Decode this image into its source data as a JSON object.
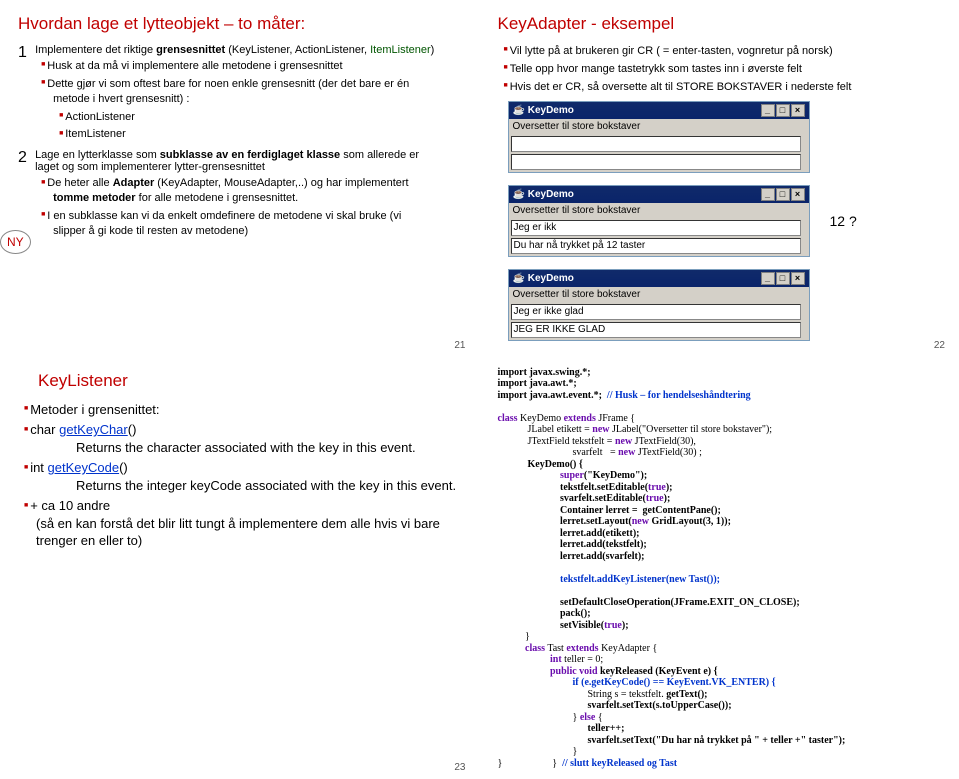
{
  "slide21": {
    "title": "Hvordan lage et lytteobjekt – to måter:",
    "num1": "1",
    "p1": "Implementere det riktige grensesnittet (KeyListener, ActionListener, ItemListener)",
    "b1": "Husk at da må vi implementere alle metodene i grensesnittet",
    "b2": "Dette gjør vi som oftest bare for noen enkle grensesnitt (der det bare er én metode i hvert grensesnitt) :",
    "b2a": "ActionListener",
    "b2b": "ItemListener",
    "num2": "2",
    "p2": "Lage en lytterklasse som subklasse av en ferdiglaget klasse som allerede er laget og som implementerer lytter-grensesnittet",
    "b3a": "De heter alle Adapter (KeyAdapter, MouseAdapter,..) og har implementert tomme metoder for alle metodene i grensesnittet.",
    "b3b": "I en subklasse kan vi da enkelt omdefinere de metodene vi skal bruke (vi slipper å gi kode til resten av metodene)",
    "ny": "NY",
    "pagenum": "21"
  },
  "slide22": {
    "title": "KeyAdapter - eksempel",
    "b1": "Vil lytte på at brukeren gir CR  ( = enter-tasten, vognretur på norsk)",
    "b2": "Telle opp hvor mange tastetrykk som tastes inn i øverste felt",
    "b3": "Hvis det er CR, så oversette alt til STORE BOKSTAVER i nederste felt",
    "win_title": "KeyDemo",
    "win_label": "Oversetter til store bokstaver",
    "win_empty": "",
    "win2_f1": "Jeg er ikk",
    "win2_f2": "Du har nå trykket på 12 taster",
    "win3_f1": "Jeg er ikke glad",
    "win3_f2": "JEG ER IKKE GLAD",
    "twelve": "12 ?",
    "pagenum": "22"
  },
  "slide23": {
    "title": "KeyListener",
    "l1": "Metoder i grensenittet:",
    "l2a": "char ",
    "l2b": "getKeyChar",
    "l2c": "()",
    "l2d": "Returns the character associated with the key in this event.",
    "l3a": "int   ",
    "l3b": "getKeyCode",
    "l3c": "()",
    "l3d": "Returns the integer keyCode associated with the key in this event.",
    "l4a": "+ ca 10 andre",
    "l4b": "(så en kan forstå det blir litt tungt å implementere dem alle hvis vi bare trenger en eller to)",
    "pagenum": "23"
  },
  "slide24": {
    "c1": "import javax.swing.*;",
    "c2": "import java.awt.*;",
    "c3": "import java.awt.event.*;  // Husk – for hendelseshåndtering",
    "c4": "class KeyDemo extends JFrame {",
    "c5": "            JLabel etikett = new JLabel(\"Oversetter til store bokstaver\");",
    "c6": "            JTextField tekstfelt = new JTextField(30),",
    "c7": "                              svarfelt   = new JTextField(30) ;",
    "c8": "            KeyDemo() {",
    "c9": "                         super(\"KeyDemo\");",
    "c10": "                         tekstfelt.setEditable(true);",
    "c11": "                         svarfelt.setEditable(true);",
    "c12": "                         Container lerret =  getContentPane();",
    "c13": "                         lerret.setLayout(new GridLayout(3, 1));",
    "c14": "                         lerret.add(etikett);",
    "c15": "                         lerret.add(tekstfelt);",
    "c16": "                         lerret.add(svarfelt);",
    "c17": "                         tekstfelt.addKeyListener(new Tast());",
    "c18": "                         setDefaultCloseOperation(JFrame.EXIT_ON_CLOSE);",
    "c19": "                         pack();",
    "c20": "                         setVisible(true);",
    "c21": "           }",
    "c22": "           class Tast extends KeyAdapter {",
    "c23": "                     int teller = 0;",
    "c24": "                     public void keyReleased (KeyEvent e) {",
    "c25": "                              if (e.getKeyCode() == KeyEvent.VK_ENTER) {",
    "c26": "                                    String s = tekstfelt. getText();",
    "c27": "                                    svarfelt.setText(s.toUpperCase());",
    "c28": "                              } else {",
    "c29": "                                    teller++;",
    "c30": "                                    svarfelt.setText(\"Du har nå trykket på \" + teller +\" taster\");",
    "c31": "                              }",
    "c32": "}                    }  // slutt keyReleased og Tast"
  }
}
